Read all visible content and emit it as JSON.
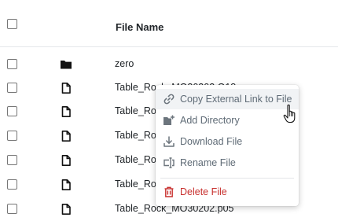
{
  "table": {
    "column_header": "File Name",
    "rows": [
      {
        "name": "zero",
        "type": "folder"
      },
      {
        "name": "Table_Rock_MO30202.O18",
        "type": "file"
      },
      {
        "name": "Table_Rock",
        "type": "file"
      },
      {
        "name": "Table_Rock",
        "type": "file"
      },
      {
        "name": "Table_Rock",
        "type": "file"
      },
      {
        "name": "Table_Rock",
        "type": "file"
      },
      {
        "name": "Table_Rock_MO30202.p05",
        "type": "file"
      }
    ]
  },
  "context_menu": {
    "items": [
      {
        "label": "Copy External Link to File",
        "icon": "link-icon"
      },
      {
        "label": "Add Directory",
        "icon": "folder-plus-icon"
      },
      {
        "label": "Download File",
        "icon": "download-icon"
      },
      {
        "label": "Rename File",
        "icon": "rename-icon"
      },
      {
        "label": "Delete File",
        "icon": "trash-icon"
      }
    ]
  },
  "colors": {
    "text": "#212529",
    "menu_text": "#5f6b76",
    "danger": "#c8312f",
    "hover_bg": "#f1f3f5"
  }
}
